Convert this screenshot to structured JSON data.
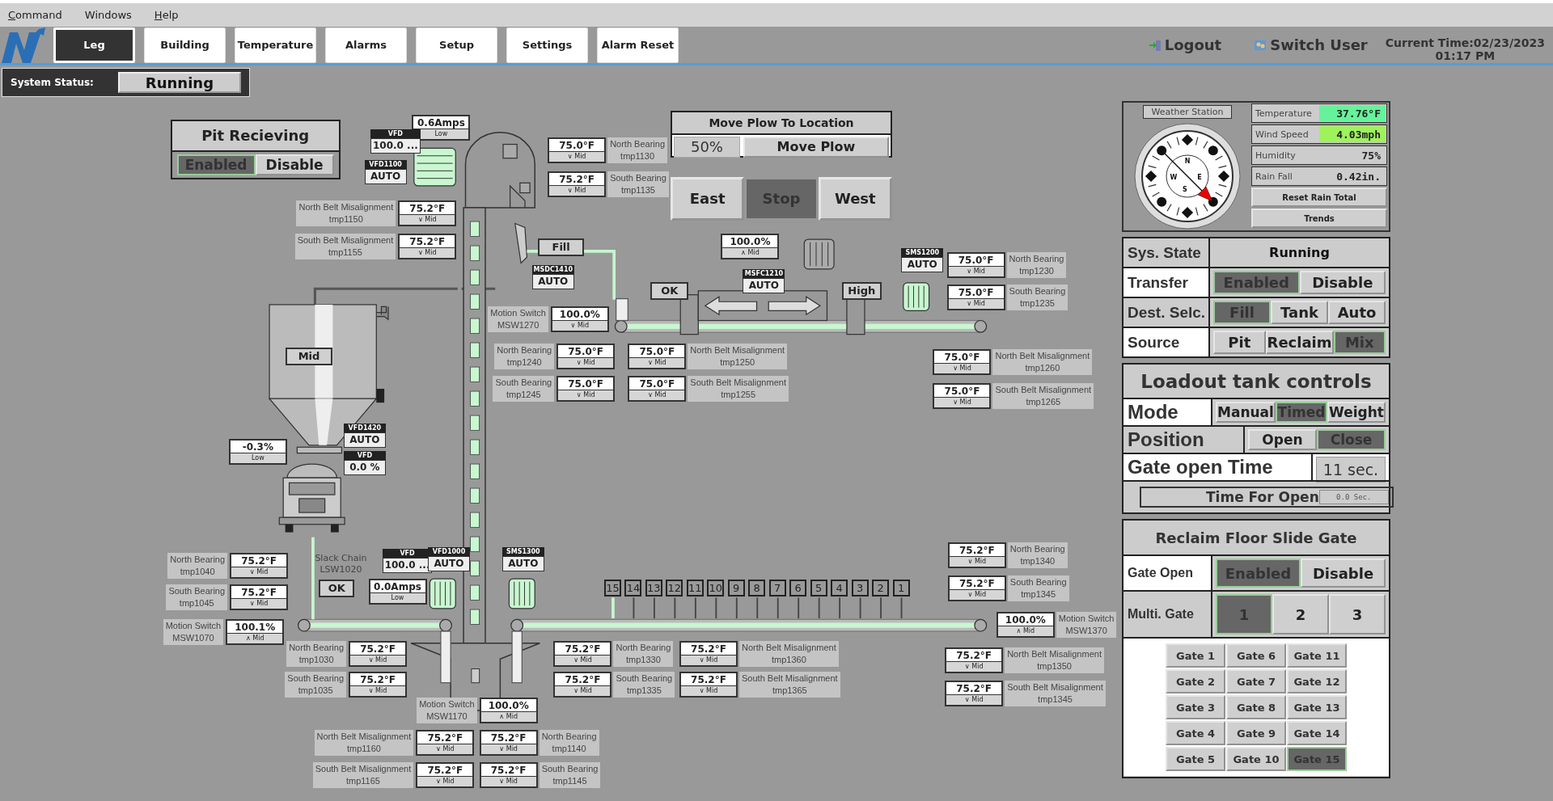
{
  "menu": [
    {
      "label": "Command",
      "mnemonic": true
    },
    {
      "label": "Windows",
      "mnemonic": false
    },
    {
      "label": "Help",
      "mnemonic": true
    }
  ],
  "tabs": [
    {
      "label": "Leg",
      "selected": true
    },
    {
      "label": "Building",
      "selected": false
    },
    {
      "label": "Temperature",
      "selected": false
    },
    {
      "label": "Alarms",
      "selected": false
    },
    {
      "label": "Setup",
      "selected": false
    },
    {
      "label": "Settings",
      "selected": false
    },
    {
      "label": "Alarm Reset",
      "selected": false
    }
  ],
  "header_actions": [
    {
      "label": "Logout",
      "kind": "logout"
    },
    {
      "label": "Switch User",
      "kind": "switch-user"
    }
  ],
  "current_time": {
    "date": "Current Time:02/23/2023",
    "time": "01:17 PM"
  },
  "system_status": {
    "label": "System Status:",
    "value": "Running"
  },
  "pit_receiving": {
    "title": "Pit Recieving",
    "options": [
      {
        "label": "Enabled",
        "selected": true
      },
      {
        "label": "Disable",
        "selected": false
      }
    ]
  },
  "move_plow": {
    "title": "Move Plow To Location",
    "value": "50%",
    "button": "Move Plow"
  },
  "plow_direction": [
    {
      "label": "East",
      "selected": false
    },
    {
      "label": "Stop",
      "selected": true
    },
    {
      "label": "West",
      "selected": false
    }
  ],
  "sensors": [
    {
      "value": "0.6Amps",
      "band": "Low"
    },
    {
      "label": "North Bearing",
      "tag": "tmp1130",
      "value": "75.0°F",
      "band": "∨ Mid"
    },
    {
      "label": "South Bearing",
      "tag": "tmp1135",
      "value": "75.2°F",
      "band": "∨ Mid"
    },
    {
      "label": "North Belt Misalignment",
      "tag": "tmp1150",
      "value": "75.2°F",
      "band": "∨ Mid"
    },
    {
      "label": "South Belt Misalignment",
      "tag": "tmp1155",
      "value": "75.2°F",
      "band": "∨ Mid"
    },
    {
      "value": "100.0%",
      "band": "∧ Mid"
    },
    {
      "label": "North Bearing",
      "tag": "tmp1230",
      "value": "75.0°F",
      "band": "∨ Mid"
    },
    {
      "label": "South Bearing",
      "tag": "tmp1235",
      "value": "75.0°F",
      "band": "∨ Mid"
    },
    {
      "label": "Motion Switch",
      "tag": "MSW1270",
      "value": "100.0%",
      "band": "∨ Mid"
    },
    {
      "label": "North Bearing",
      "tag": "tmp1240",
      "value": "75.0°F",
      "band": "∨ Mid"
    },
    {
      "label": "North Belt Misalignment",
      "tag": "tmp1250",
      "value": "75.0°F",
      "band": "∨ Mid"
    },
    {
      "label": "North Belt Misalignment",
      "tag": "tmp1260",
      "value": "75.0°F",
      "band": "∨ Mid"
    },
    {
      "label": "South Bearing",
      "tag": "tmp1245",
      "value": "75.0°F",
      "band": "∨ Mid"
    },
    {
      "label": "South Belt Misalignment",
      "tag": "tmp1255",
      "value": "75.0°F",
      "band": "∨ Mid"
    },
    {
      "label": "South Belt Misalignment",
      "tag": "tmp1265",
      "value": "75.0°F",
      "band": "∨ Mid"
    },
    {
      "value": "-0.3%",
      "band": "Low"
    },
    {
      "label": "North Bearing",
      "tag": "tmp1340",
      "value": "75.2°F",
      "band": "∨ Mid"
    },
    {
      "label": "North Bearing",
      "tag": "tmp1040",
      "value": "75.2°F",
      "band": "∨ Mid"
    },
    {
      "label": "South Bearing",
      "tag": "tmp1045",
      "value": "75.2°F",
      "band": "∨ Mid"
    },
    {
      "value": "0.0Amps",
      "band": "Low"
    },
    {
      "label": "South Bearing",
      "tag": "tmp1345",
      "value": "75.2°F",
      "band": "∨ Mid"
    },
    {
      "label": "Motion Switch",
      "tag": "MSW1370",
      "value": "100.0%",
      "band": "∧ Mid"
    },
    {
      "label": "Motion Switch",
      "tag": "MSW1070",
      "value": "100.1%",
      "band": "∧ Mid"
    },
    {
      "label": "North Bearing",
      "tag": "tmp1030",
      "value": "75.2°F",
      "band": "∨ Mid"
    },
    {
      "label": "North Bearing",
      "tag": "tmp1330",
      "value": "75.2°F",
      "band": "∨ Mid"
    },
    {
      "label": "North Belt Misalignment",
      "tag": "tmp1360",
      "value": "75.2°F",
      "band": "∨ Mid"
    },
    {
      "label": "North Belt Misalignment",
      "tag": "tmp1350",
      "value": "75.2°F",
      "band": "∨ Mid"
    },
    {
      "label": "South Bearing",
      "tag": "tmp1035",
      "value": "75.2°F",
      "band": "∨ Mid"
    },
    {
      "label": "South Bearing",
      "tag": "tmp1335",
      "value": "75.2°F",
      "band": "∨ Mid"
    },
    {
      "label": "South Belt Misalignment",
      "tag": "tmp1365",
      "value": "75.2°F",
      "band": "∨ Mid"
    },
    {
      "label": "South Belt Misalignment",
      "tag": "tmp1345",
      "value": "75.2°F",
      "band": "∨ Mid"
    },
    {
      "label": "Motion Switch",
      "tag": "MSW1170",
      "value": "100.0%",
      "band": "∧ Mid"
    },
    {
      "label": "North Belt Misalignment",
      "tag": "tmp1160",
      "value": "75.2°F",
      "band": "∨ Mid"
    },
    {
      "label": "North Bearing",
      "tag": "tmp1140",
      "value": "75.2°F",
      "band": "∨ Mid"
    },
    {
      "label": "South Belt Misalignment",
      "tag": "tmp1165",
      "value": "75.2°F",
      "band": "∨ Mid"
    },
    {
      "label": "South Bearing",
      "tag": "tmp1145",
      "value": "75.2°F",
      "band": "∨ Mid"
    }
  ],
  "drives": [
    {
      "tag": "VFD",
      "value": "100.0 ..."
    },
    {
      "tag": "VFD1100",
      "value": "AUTO"
    },
    {
      "tag": "MSDC1410",
      "value": "AUTO"
    },
    {
      "tag": "MSFC1210",
      "value": "AUTO"
    },
    {
      "tag": "SMS1200",
      "value": "AUTO"
    },
    {
      "tag": "VFD1420",
      "value": "AUTO"
    },
    {
      "tag": "VFD",
      "value": "0.0 %"
    },
    {
      "tag": "VFD",
      "value": "100.0 ..."
    },
    {
      "tag": "VFD1000",
      "value": "AUTO"
    },
    {
      "tag": "SMS1300",
      "value": "AUTO"
    }
  ],
  "status_labels": [
    "Fill",
    "OK",
    "High",
    "Mid",
    "OK"
  ],
  "slack_chain": {
    "label": "Slack Chain",
    "tag": "LSW1020"
  },
  "gate_strip": [
    {
      "label": "15",
      "open": true
    },
    {
      "label": "14",
      "open": false
    },
    {
      "label": "13",
      "open": false
    },
    {
      "label": "12",
      "open": false
    },
    {
      "label": "11",
      "open": false
    },
    {
      "label": "10",
      "open": false
    },
    {
      "label": "9",
      "open": false
    },
    {
      "label": "8",
      "open": false
    },
    {
      "label": "7",
      "open": false
    },
    {
      "label": "6",
      "open": false
    },
    {
      "label": "5",
      "open": false
    },
    {
      "label": "4",
      "open": false
    },
    {
      "label": "3",
      "open": false
    },
    {
      "label": "2",
      "open": false
    },
    {
      "label": "1",
      "open": false
    }
  ],
  "weather": {
    "title": "Weather Station",
    "compass_labels": [
      "N",
      "E",
      "S",
      "W"
    ],
    "readings": [
      {
        "label": "Temperature",
        "value": "37.76°F",
        "color": "#66f29a"
      },
      {
        "label": "Wind Speed",
        "value": "4.03mph",
        "color": "#9ef25c"
      },
      {
        "label": "Humidity",
        "value": "75%",
        "color": "#cccccc"
      },
      {
        "label": "Rain Fall",
        "value": "0.42in.",
        "color": "#cccccc"
      }
    ],
    "buttons": [
      "Reset Rain Total",
      "Trends"
    ]
  },
  "system": [
    {
      "label": "Sys. State",
      "kind": "value",
      "value": "Running"
    },
    {
      "label": "Transfer",
      "kind": "options",
      "options": [
        {
          "label": "Enabled",
          "selected": true
        },
        {
          "label": "Disable",
          "selected": false
        }
      ]
    },
    {
      "label": "Dest. Selc.",
      "kind": "options",
      "options": [
        {
          "label": "Fill",
          "selected": true
        },
        {
          "label": "Tank",
          "selected": false
        },
        {
          "label": "Auto",
          "selected": false
        }
      ]
    },
    {
      "label": "Source",
      "kind": "options",
      "options": [
        {
          "label": "Pit",
          "selected": false
        },
        {
          "label": "Reclaim",
          "selected": false
        },
        {
          "label": "Mix",
          "selected": true
        }
      ]
    }
  ],
  "loadout": {
    "title": "Loadout tank controls",
    "rows": [
      {
        "label": "Mode",
        "kind": "options",
        "options": [
          {
            "label": "Manual",
            "selected": false
          },
          {
            "label": "Timed",
            "selected": true
          },
          {
            "label": "Weight",
            "selected": false
          }
        ]
      },
      {
        "label": "Position",
        "kind": "options",
        "options": [
          {
            "label": "Open",
            "selected": false
          },
          {
            "label": "Close",
            "selected": true
          }
        ]
      },
      {
        "label": "Gate open Time",
        "kind": "value",
        "value": "11 sec."
      }
    ],
    "time_for_open": {
      "label": "Time For Open",
      "value": "0.0 Sec."
    }
  },
  "reclaim": {
    "title": "Reclaim Floor Slide Gate",
    "rows": [
      {
        "label": "Gate Open",
        "kind": "options",
        "options": [
          {
            "label": "Enabled",
            "selected": true
          },
          {
            "label": "Disable",
            "selected": false
          }
        ]
      },
      {
        "label": "Multi. Gate",
        "kind": "options",
        "options": [
          {
            "label": "1",
            "selected": true
          },
          {
            "label": "2",
            "selected": false
          },
          {
            "label": "3",
            "selected": false
          }
        ]
      }
    ],
    "gates": [
      {
        "label": "Gate 1",
        "selected": false
      },
      {
        "label": "Gate 2",
        "selected": false
      },
      {
        "label": "Gate 3",
        "selected": false
      },
      {
        "label": "Gate 4",
        "selected": false
      },
      {
        "label": "Gate 5",
        "selected": false
      },
      {
        "label": "Gate 6",
        "selected": false
      },
      {
        "label": "Gate 7",
        "selected": false
      },
      {
        "label": "Gate 8",
        "selected": false
      },
      {
        "label": "Gate 9",
        "selected": false
      },
      {
        "label": "Gate 10",
        "selected": false
      },
      {
        "label": "Gate 11",
        "selected": false
      },
      {
        "label": "Gate 12",
        "selected": false
      },
      {
        "label": "Gate 13",
        "selected": false
      },
      {
        "label": "Gate 14",
        "selected": false
      },
      {
        "label": "Gate 15",
        "selected": true
      }
    ]
  }
}
